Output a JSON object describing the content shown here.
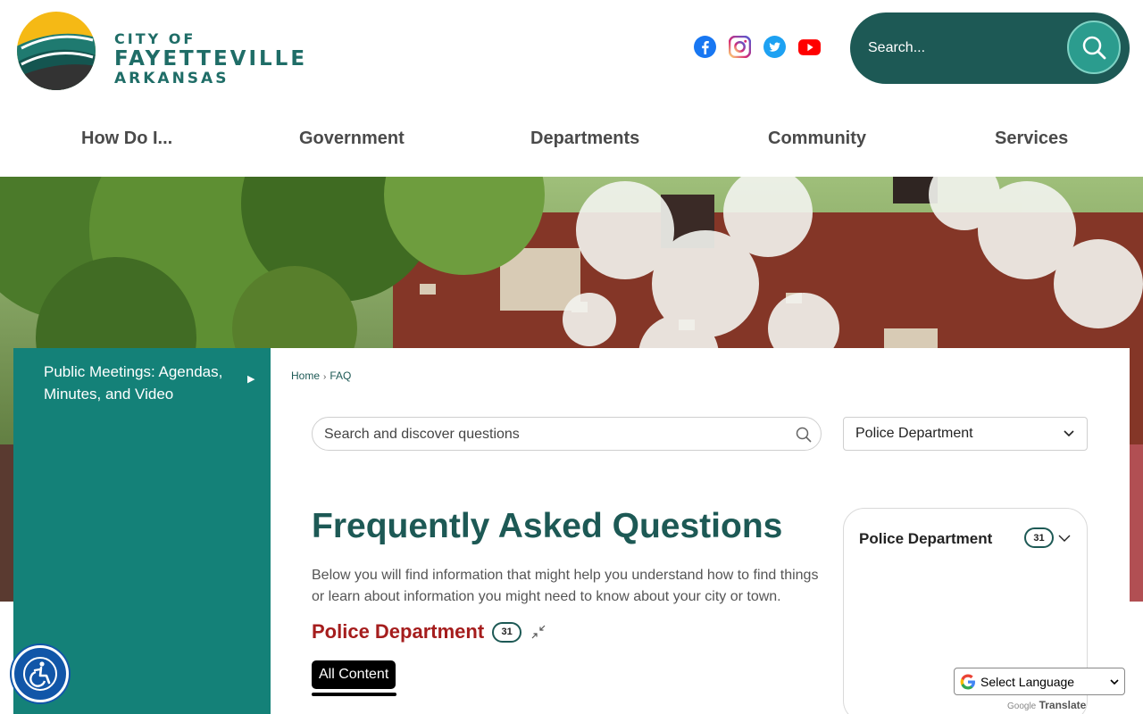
{
  "header": {
    "logo": {
      "line1": "CITY OF",
      "line2": "FAYETTEVILLE",
      "line3": "ARKANSAS"
    },
    "social": [
      {
        "name": "facebook-icon",
        "color": "#1877f2"
      },
      {
        "name": "instagram-icon",
        "color": "#c13584"
      },
      {
        "name": "twitter-icon",
        "color": "#1da1f2"
      },
      {
        "name": "youtube-icon",
        "color": "#ff0000"
      }
    ],
    "search": {
      "placeholder": "Search..."
    }
  },
  "nav": {
    "items": [
      "How Do I...",
      "Government",
      "Departments",
      "Community",
      "Services"
    ]
  },
  "sidebar": {
    "link_label": "Public Meetings: Agendas, Minutes, and Video"
  },
  "breadcrumb": {
    "home": "Home",
    "current": "FAQ"
  },
  "faq": {
    "search_placeholder": "Search and discover questions",
    "department_select": "Police Department",
    "title": "Frequently Asked Questions",
    "description": "Below you will find information that might help you understand how to find things or learn about information you might need to know about your city or town.",
    "category": {
      "name": "Police Department",
      "count": "31"
    },
    "filter_tab": "All Content",
    "panel": {
      "name": "Police Department",
      "count": "31"
    }
  },
  "translate": {
    "select_label": "Select Language",
    "powered_by": "Google",
    "translate_label": "Translate"
  },
  "colors": {
    "brand_teal": "#1d5955",
    "sidebar_teal": "#148178",
    "category_red": "#a51d1d",
    "accessibility_blue": "#1156a8"
  }
}
